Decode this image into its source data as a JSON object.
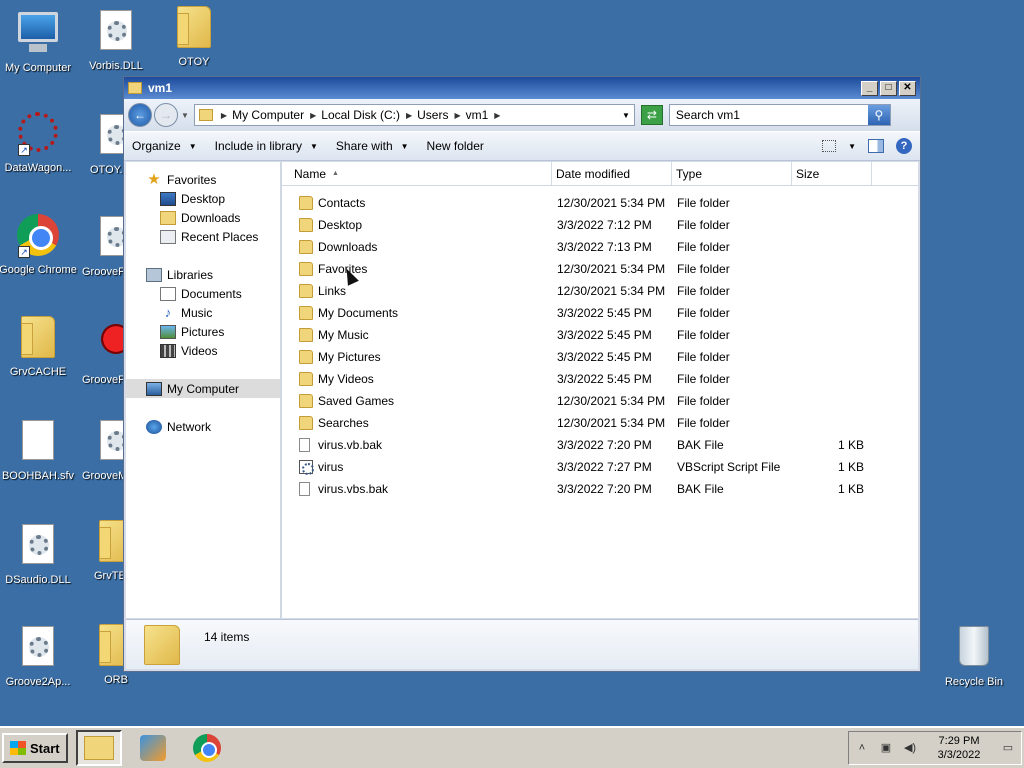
{
  "desktop": {
    "icons": [
      {
        "label": "My Computer"
      },
      {
        "label": "Vorbis.DLL"
      },
      {
        "label": "OTOY"
      },
      {
        "label": "DataWagon..."
      },
      {
        "label": "OTOY."
      },
      {
        "label": "Google Chrome"
      },
      {
        "label": "GrooveF"
      },
      {
        "label": "GrvCACHE"
      },
      {
        "label": "GrooveF"
      },
      {
        "label": "BOOHBAH.sfv"
      },
      {
        "label": "GrooveM"
      },
      {
        "label": "DSaudio.DLL"
      },
      {
        "label": "GrvTE"
      },
      {
        "label": "Groove2Ap..."
      },
      {
        "label": "ORB"
      },
      {
        "label": "Recycle Bin"
      }
    ]
  },
  "window": {
    "title": "vm1",
    "buttons": {
      "minimize": "_",
      "maximize": "□",
      "close": "✕"
    }
  },
  "address": {
    "crumbs": [
      "My Computer",
      "Local Disk (C:)",
      "Users",
      "vm1"
    ],
    "search_placeholder": "Search vm1"
  },
  "toolbar": {
    "organize": "Organize",
    "include_library": "Include in library",
    "share_with": "Share with",
    "new_folder": "New folder"
  },
  "nav": {
    "favorites": "Favorites",
    "desktop": "Desktop",
    "downloads": "Downloads",
    "recent_places": "Recent Places",
    "libraries": "Libraries",
    "documents": "Documents",
    "music": "Music",
    "pictures": "Pictures",
    "videos": "Videos",
    "my_computer": "My Computer",
    "network": "Network"
  },
  "columns": {
    "name": "Name",
    "date": "Date modified",
    "type": "Type",
    "size": "Size"
  },
  "files": [
    {
      "name": "Contacts",
      "date": "12/30/2021 5:34 PM",
      "type": "File folder",
      "size": "",
      "icon": "folder"
    },
    {
      "name": "Desktop",
      "date": "3/3/2022 7:12 PM",
      "type": "File folder",
      "size": "",
      "icon": "folder"
    },
    {
      "name": "Downloads",
      "date": "3/3/2022 7:13 PM",
      "type": "File folder",
      "size": "",
      "icon": "folder"
    },
    {
      "name": "Favorites",
      "date": "12/30/2021 5:34 PM",
      "type": "File folder",
      "size": "",
      "icon": "folder"
    },
    {
      "name": "Links",
      "date": "12/30/2021 5:34 PM",
      "type": "File folder",
      "size": "",
      "icon": "folder"
    },
    {
      "name": "My Documents",
      "date": "3/3/2022 5:45 PM",
      "type": "File folder",
      "size": "",
      "icon": "folder"
    },
    {
      "name": "My Music",
      "date": "3/3/2022 5:45 PM",
      "type": "File folder",
      "size": "",
      "icon": "folder"
    },
    {
      "name": "My Pictures",
      "date": "3/3/2022 5:45 PM",
      "type": "File folder",
      "size": "",
      "icon": "folder"
    },
    {
      "name": "My Videos",
      "date": "3/3/2022 5:45 PM",
      "type": "File folder",
      "size": "",
      "icon": "folder"
    },
    {
      "name": "Saved Games",
      "date": "12/30/2021 5:34 PM",
      "type": "File folder",
      "size": "",
      "icon": "folder"
    },
    {
      "name": "Searches",
      "date": "12/30/2021 5:34 PM",
      "type": "File folder",
      "size": "",
      "icon": "folder"
    },
    {
      "name": "virus.vb.bak",
      "date": "3/3/2022 7:20 PM",
      "type": "BAK File",
      "size": "1 KB",
      "icon": "file"
    },
    {
      "name": "virus",
      "date": "3/3/2022 7:27 PM",
      "type": "VBScript Script File",
      "size": "1 KB",
      "icon": "script"
    },
    {
      "name": "virus.vbs.bak",
      "date": "3/3/2022 7:20 PM",
      "type": "BAK File",
      "size": "1 KB",
      "icon": "file"
    }
  ],
  "status": {
    "item_count": "14 items"
  },
  "taskbar": {
    "start_label": "Start",
    "time": "7:29 PM",
    "date": "3/3/2022"
  }
}
